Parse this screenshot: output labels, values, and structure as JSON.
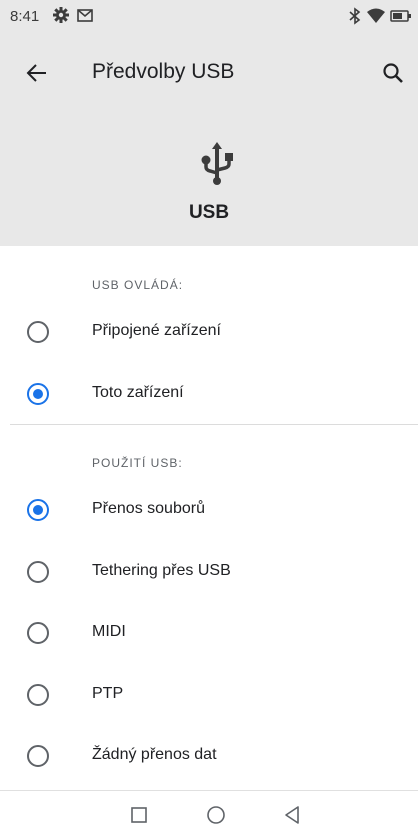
{
  "status_bar": {
    "time": "8:41",
    "left_icons": [
      "settings-icon",
      "gmail-icon"
    ],
    "right_icons": [
      "bluetooth-icon",
      "wifi-icon",
      "battery-icon"
    ]
  },
  "toolbar": {
    "title": "Předvolby USB",
    "back_icon": "arrow-back-icon",
    "search_icon": "search-icon"
  },
  "header": {
    "icon": "usb-icon",
    "title": "USB"
  },
  "sections": {
    "controls": {
      "header": "USB OVLÁDÁ:",
      "options": [
        {
          "label": "Připojené zařízení",
          "checked": false
        },
        {
          "label": "Toto zařízení",
          "checked": true
        }
      ]
    },
    "usage": {
      "header": "POUŽITÍ USB:",
      "options": [
        {
          "label": "Přenos souborů",
          "checked": true
        },
        {
          "label": "Tethering přes USB",
          "checked": false
        },
        {
          "label": "MIDI",
          "checked": false
        },
        {
          "label": "PTP",
          "checked": false
        },
        {
          "label": "Žádný přenos dat",
          "checked": false
        }
      ]
    }
  },
  "navbar": {
    "icons": [
      "recents-square-icon",
      "home-circle-icon",
      "back-triangle-icon"
    ]
  },
  "colors": {
    "accent": "#1a73e8",
    "header_bg": "#e8e8e8",
    "text": "#202124",
    "secondary_text": "#5f6368"
  }
}
